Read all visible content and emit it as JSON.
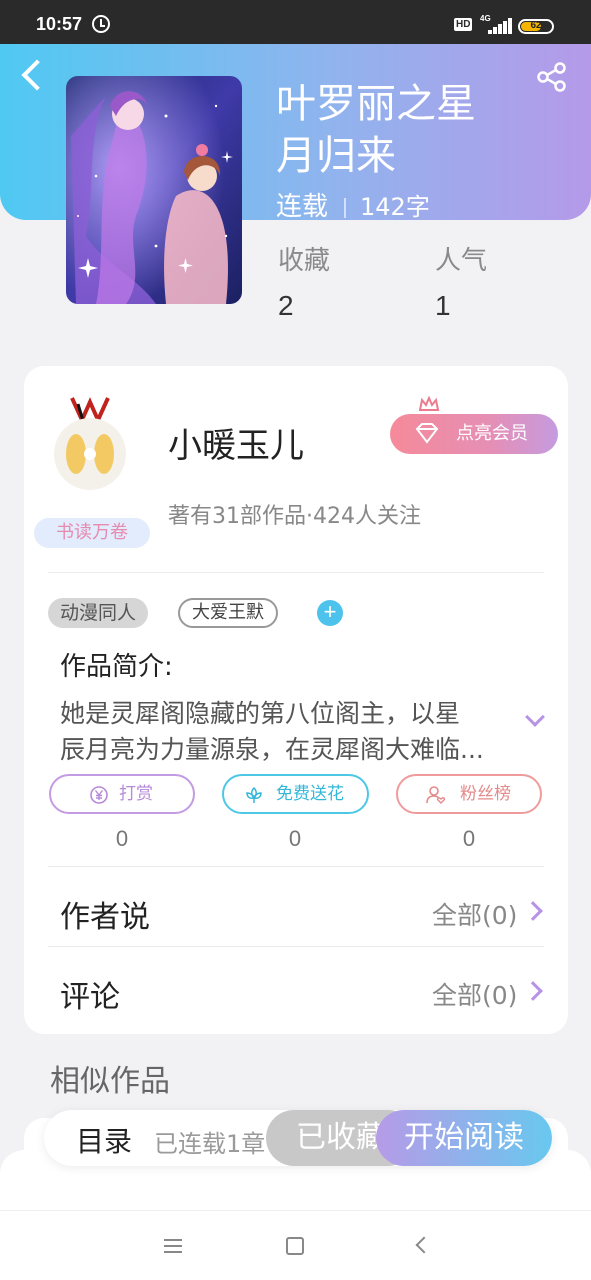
{
  "status_bar": {
    "time": "10:57",
    "hd": "HD",
    "network": "4G",
    "battery": "62",
    "battery_level": 0.62
  },
  "header": {
    "back_icon": "back-arrow-icon",
    "share_icon": "share-icon",
    "gradient": [
      "#4fc9f2",
      "#b59ae9"
    ]
  },
  "book": {
    "title_line1": "叶罗丽之星",
    "title_line2": "月归来",
    "status": "连载",
    "word_count": "142字",
    "stats": [
      {
        "label": "收藏",
        "value": "2"
      },
      {
        "label": "人气",
        "value": "1"
      }
    ]
  },
  "author": {
    "name": "小暖玉儿",
    "badge": "书读万卷",
    "info": "著有31部作品·424人关注",
    "vip_button": "点亮会员"
  },
  "tags": [
    "动漫同人",
    "大爱王默"
  ],
  "intro": {
    "title": "作品简介:",
    "line1": "她是灵犀阁隐藏的第八位阁主，以星",
    "line2": "辰月亮为力量源泉，在灵犀阁大难临..."
  },
  "actions": [
    {
      "label": "打赏",
      "count": "0",
      "icon": "yen-coin-icon",
      "color": "#b58ad9"
    },
    {
      "label": "免费送花",
      "count": "0",
      "icon": "flower-icon",
      "color": "#35b8d8"
    },
    {
      "label": "粉丝榜",
      "count": "0",
      "icon": "fan-user-icon",
      "color": "#e48a8a"
    }
  ],
  "rows": [
    {
      "title": "作者说",
      "value": "全部(0)"
    },
    {
      "title": "评论",
      "value": "全部(0)"
    }
  ],
  "similar": {
    "title": "相似作品"
  },
  "bottom_bar": {
    "toc": "目录",
    "progress": "已连载1章",
    "collect": "已收藏",
    "read": "开始阅读"
  }
}
